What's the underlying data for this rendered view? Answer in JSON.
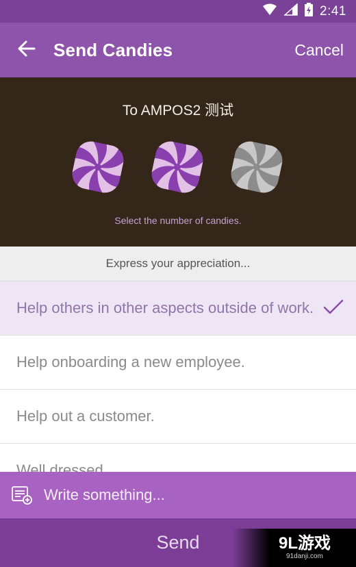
{
  "status_bar": {
    "time": "2:41"
  },
  "app_bar": {
    "title": "Send Candies",
    "cancel_label": "Cancel"
  },
  "candy_panel": {
    "recipient": "To AMPOS2 测试",
    "selected_count": 2,
    "max_count": 3,
    "hint": "Select the number of candies.",
    "colors": {
      "selected_primary": "#8a3fae",
      "selected_secondary": "#f2d7ee",
      "unselected_primary": "#8c8c8c",
      "unselected_secondary": "#d2d2d2"
    }
  },
  "express": {
    "header": "Express your appreciation..."
  },
  "options": [
    {
      "label": "Help others in other aspects outside of work.",
      "selected": true
    },
    {
      "label": "Help onboarding a new employee.",
      "selected": false
    },
    {
      "label": "Help out a customer.",
      "selected": false
    },
    {
      "label": "Well dressed",
      "selected": false
    }
  ],
  "composer": {
    "placeholder": "Write something..."
  },
  "send": {
    "label": "Send"
  },
  "watermark": {
    "main": "9L游戏",
    "sub": "91danji.com"
  },
  "colors": {
    "accent": "#8e53aa",
    "status_bar": "#7a4296",
    "panel_bg": "#35261a",
    "send_bar": "#7c3d97",
    "composer": "#a863c2"
  }
}
